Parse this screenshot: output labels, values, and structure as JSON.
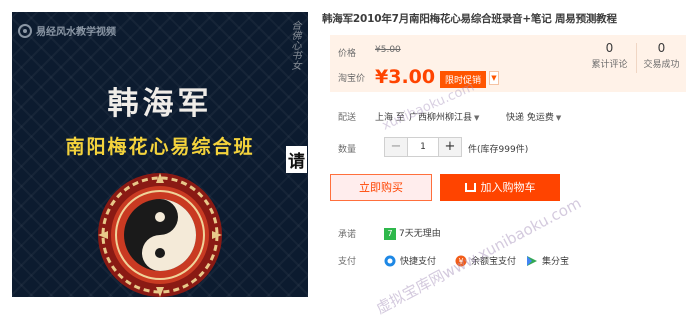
{
  "image": {
    "brand": "易经风水教学视频",
    "seal_text": "合佛心书女",
    "author": "韩海军",
    "course": "南阳梅花心易综合班",
    "side_glyph": "请"
  },
  "product": {
    "title": "韩海军2010年7月南阳梅花心易综合班录音+笔记 周易预测教程"
  },
  "price": {
    "orig_label": "价格",
    "orig_value": "¥5.00",
    "sale_label": "淘宝价",
    "sale_value": "¥3.00",
    "promo_badge": "限时促销",
    "reviews_count": "0",
    "reviews_label": "累计评论",
    "sales_count": "0",
    "sales_label": "交易成功"
  },
  "shipping": {
    "label": "配送",
    "from": "上海 至",
    "to": "广西柳州柳江县",
    "method": "快递 免运费"
  },
  "quantity": {
    "label": "数量",
    "value": "1",
    "minus": "−",
    "plus": "+",
    "unit_stock": "件(库存999件)"
  },
  "actions": {
    "buy_now": "立即购买",
    "add_cart": "加入购物车"
  },
  "promise": {
    "label": "承诺",
    "icon_glyph": "7",
    "text": "7天无理由"
  },
  "payment": {
    "label": "支付",
    "methods": [
      "快捷支付",
      "余额宝支付",
      "集分宝"
    ]
  },
  "watermarks": {
    "site1": "xunibaoku.com",
    "site2": "虚拟宝库网www.xunibaoku.com"
  },
  "colors": {
    "accent": "#ff4400",
    "price_bg": "#fff2e8",
    "course_text": "#f4d33c",
    "image_bg": "#0c1b2f"
  }
}
